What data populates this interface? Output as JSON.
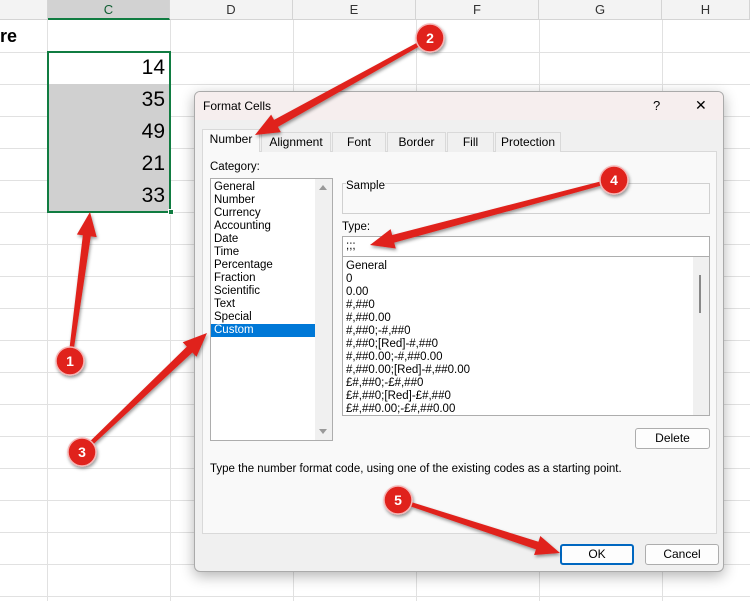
{
  "sheet": {
    "columns": [
      "C",
      "D",
      "E",
      "F",
      "G",
      "H"
    ],
    "partial_text": "re",
    "values": [
      "14",
      "35",
      "49",
      "21",
      "33"
    ]
  },
  "dialog": {
    "title": "Format Cells",
    "help": "?",
    "close": "✕",
    "tabs": [
      "Number",
      "Alignment",
      "Font",
      "Border",
      "Fill",
      "Protection"
    ],
    "category_label": "Category:",
    "categories": [
      "General",
      "Number",
      "Currency",
      "Accounting",
      "Date",
      "Time",
      "Percentage",
      "Fraction",
      "Scientific",
      "Text",
      "Special",
      "Custom"
    ],
    "selected_category": "Custom",
    "sample_label": "Sample",
    "type_label": "Type:",
    "type_value": ";;;",
    "formats": [
      "General",
      "0",
      "0.00",
      "#,##0",
      "#,##0.00",
      "#,##0;-#,##0",
      "#,##0;[Red]-#,##0",
      "#,##0.00;-#,##0.00",
      "#,##0.00;[Red]-#,##0.00",
      "£#,##0;-£#,##0",
      "£#,##0;[Red]-£#,##0",
      "£#,##0.00;-£#,##0.00"
    ],
    "delete_label": "Delete",
    "description": "Type the number format code, using one of the existing codes as a starting point.",
    "ok_label": "OK",
    "cancel_label": "Cancel"
  },
  "annotations": [
    "1",
    "2",
    "3",
    "4",
    "5"
  ],
  "colors": {
    "annotation": "#e0201b",
    "selection": "#0078d7",
    "excel_green": "#107c41"
  }
}
